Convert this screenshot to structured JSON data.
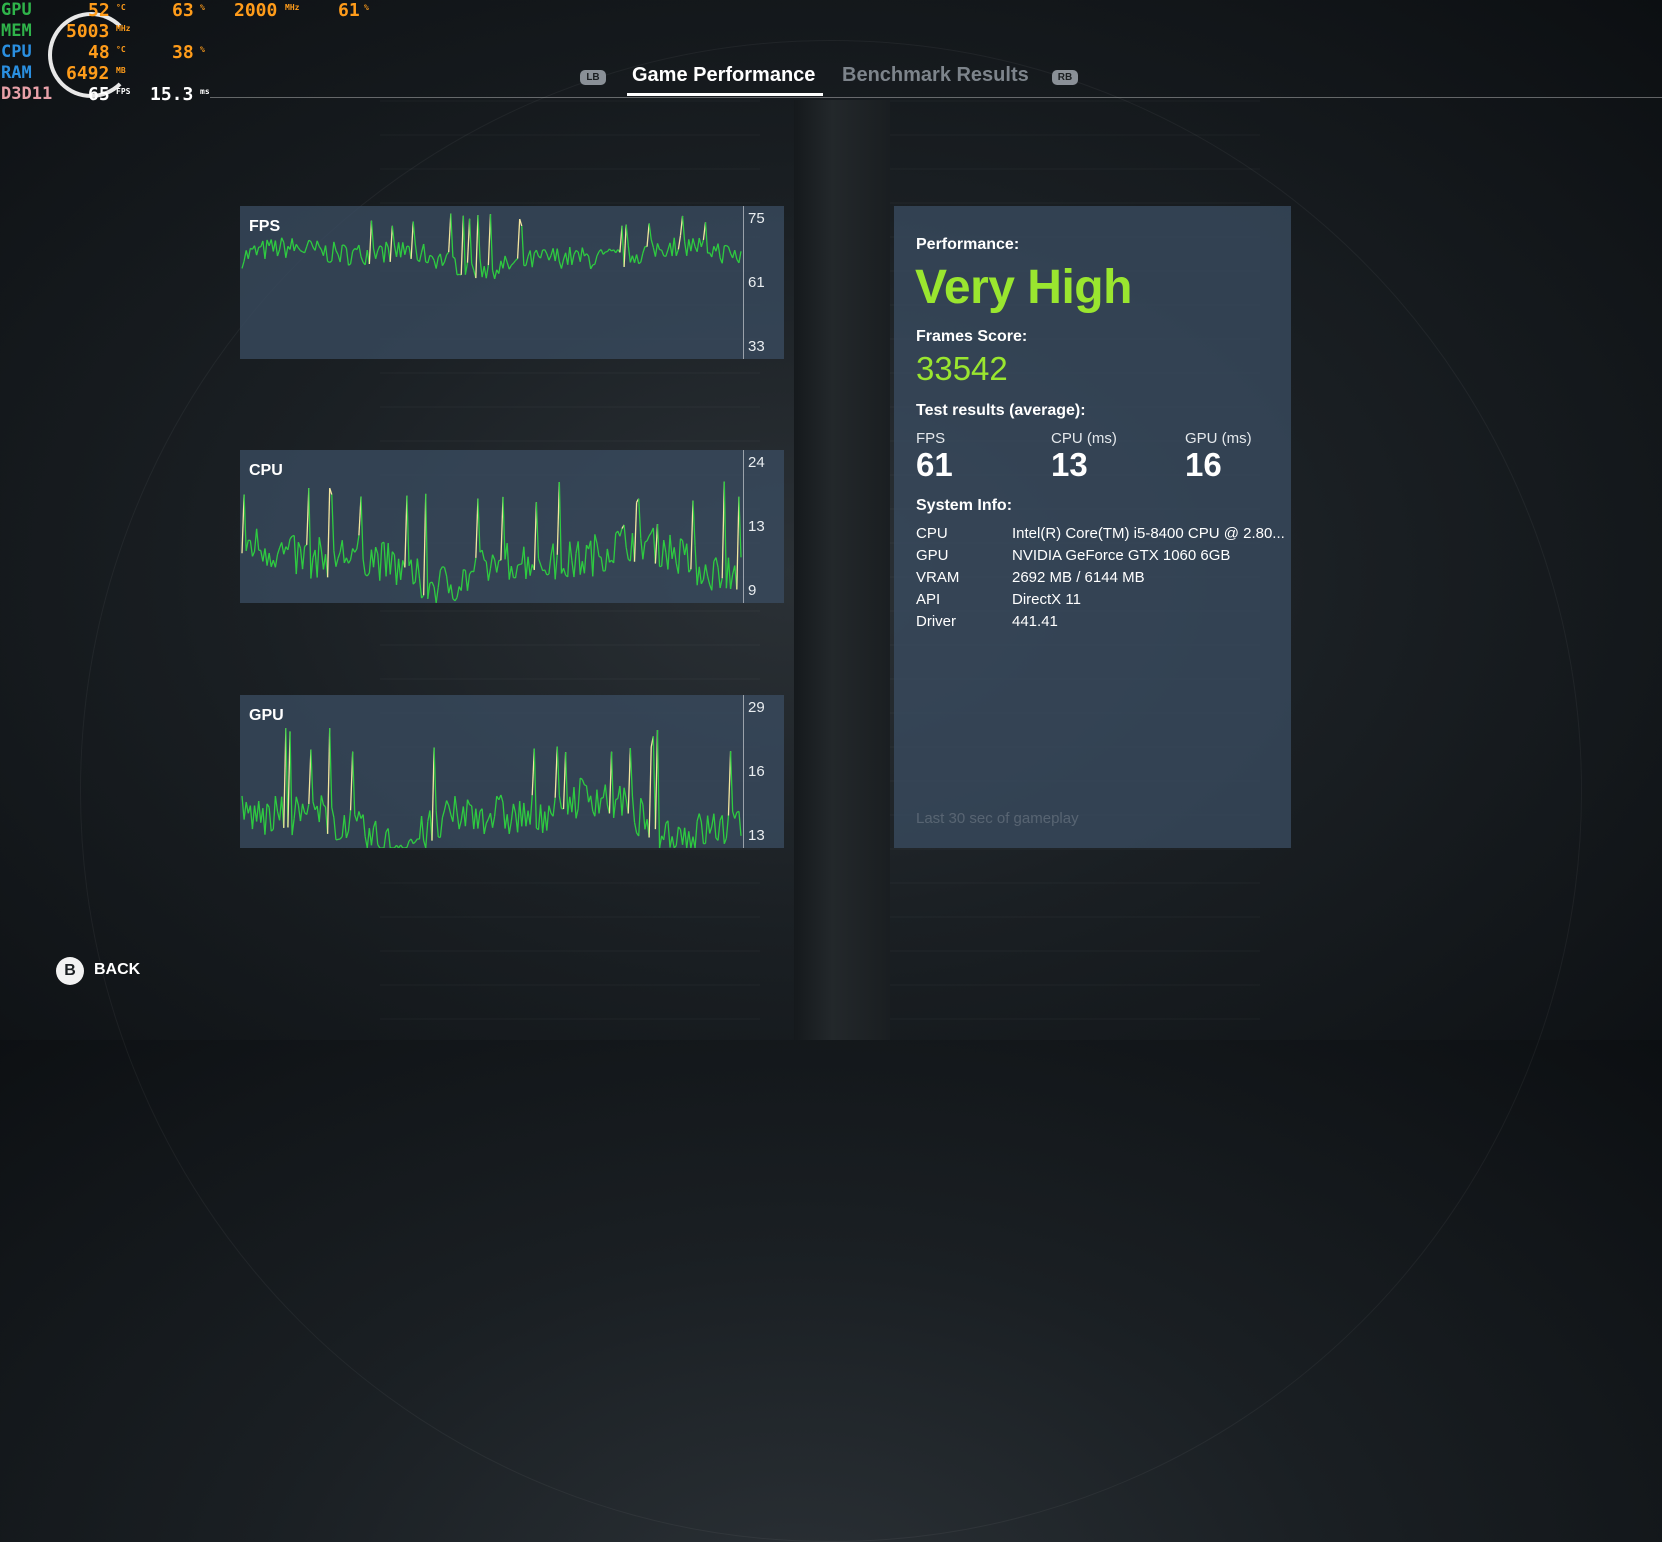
{
  "osd": {
    "gpu": {
      "label": "GPU",
      "temp": "52",
      "temp_unit": "°C",
      "load": "63",
      "load_unit": "%",
      "clock": "2000",
      "clock_unit": "MHz",
      "fan": "61",
      "fan_unit": "%"
    },
    "mem": {
      "label": "MEM",
      "clock": "5003",
      "clock_unit": "MHz"
    },
    "cpu": {
      "label": "CPU",
      "temp": "48",
      "temp_unit": "°C",
      "load": "38",
      "load_unit": "%"
    },
    "ram": {
      "label": "RAM",
      "used": "6492",
      "used_unit": "MB"
    },
    "api": {
      "label": "D3D11",
      "fps": "65",
      "fps_unit": "FPS",
      "frametime": "15.3",
      "frametime_unit": "ms"
    },
    "colors": {
      "gpu": "#2fb34a",
      "mem": "#2fb34a",
      "cpu": "#2a8fe0",
      "ram": "#2a8fe0",
      "api": "#e8a0a8",
      "value": "#ff9c1a"
    }
  },
  "tabs": {
    "left_bumper": "LB",
    "right_bumper": "RB",
    "items": [
      {
        "label": "Game Performance",
        "active": true
      },
      {
        "label": "Benchmark Results",
        "active": false
      }
    ]
  },
  "charts": [
    {
      "title": "FPS",
      "ticks": [
        "75",
        "61",
        "33"
      ]
    },
    {
      "title": "CPU",
      "ticks": [
        "24",
        "13",
        "9"
      ]
    },
    {
      "title": "GPU",
      "ticks": [
        "29",
        "16",
        "13"
      ]
    }
  ],
  "chart_data": [
    {
      "type": "line",
      "title": "FPS",
      "ylim": [
        33,
        75
      ],
      "y_ticks": [
        75,
        61,
        33
      ],
      "mean_value": 61,
      "min_value": 55,
      "max_value": 73,
      "colors": {
        "normal": "#2ecc40",
        "spike": "#f3e6a0"
      }
    },
    {
      "type": "line",
      "title": "CPU",
      "ylim": [
        9,
        24
      ],
      "y_ticks": [
        24,
        13,
        9
      ],
      "mean_value": 13,
      "min_value": 9,
      "max_value": 21,
      "colors": {
        "normal": "#2ecc40",
        "spike": "#f3e6a0"
      }
    },
    {
      "type": "line",
      "title": "GPU",
      "ylim": [
        13,
        29
      ],
      "y_ticks": [
        29,
        16,
        13
      ],
      "mean_value": 16,
      "min_value": 13,
      "max_value": 26,
      "colors": {
        "normal": "#2ecc40",
        "spike": "#f3e6a0"
      }
    }
  ],
  "results": {
    "performance_label": "Performance:",
    "performance_value": "Very High",
    "frames_label": "Frames Score:",
    "frames_value": "33542",
    "test_label": "Test results (average):",
    "fps_label": "FPS",
    "fps_value": "61",
    "cpu_label": "CPU (ms)",
    "cpu_value": "13",
    "gpu_label": "GPU (ms)",
    "gpu_value": "16",
    "accent": "#9ae62f"
  },
  "system": {
    "label": "System Info:",
    "rows": [
      {
        "key": "CPU",
        "value": "Intel(R) Core(TM) i5-8400 CPU @ 2.80..."
      },
      {
        "key": "GPU",
        "value": "NVIDIA GeForce GTX 1060 6GB"
      },
      {
        "key": "VRAM",
        "value": "2692 MB / 6144 MB"
      },
      {
        "key": "API",
        "value": "DirectX 11"
      },
      {
        "key": "Driver",
        "value": "441.41"
      }
    ],
    "footnote": "Last 30 sec of gameplay"
  },
  "back": {
    "button": "B",
    "label": "BACK"
  }
}
